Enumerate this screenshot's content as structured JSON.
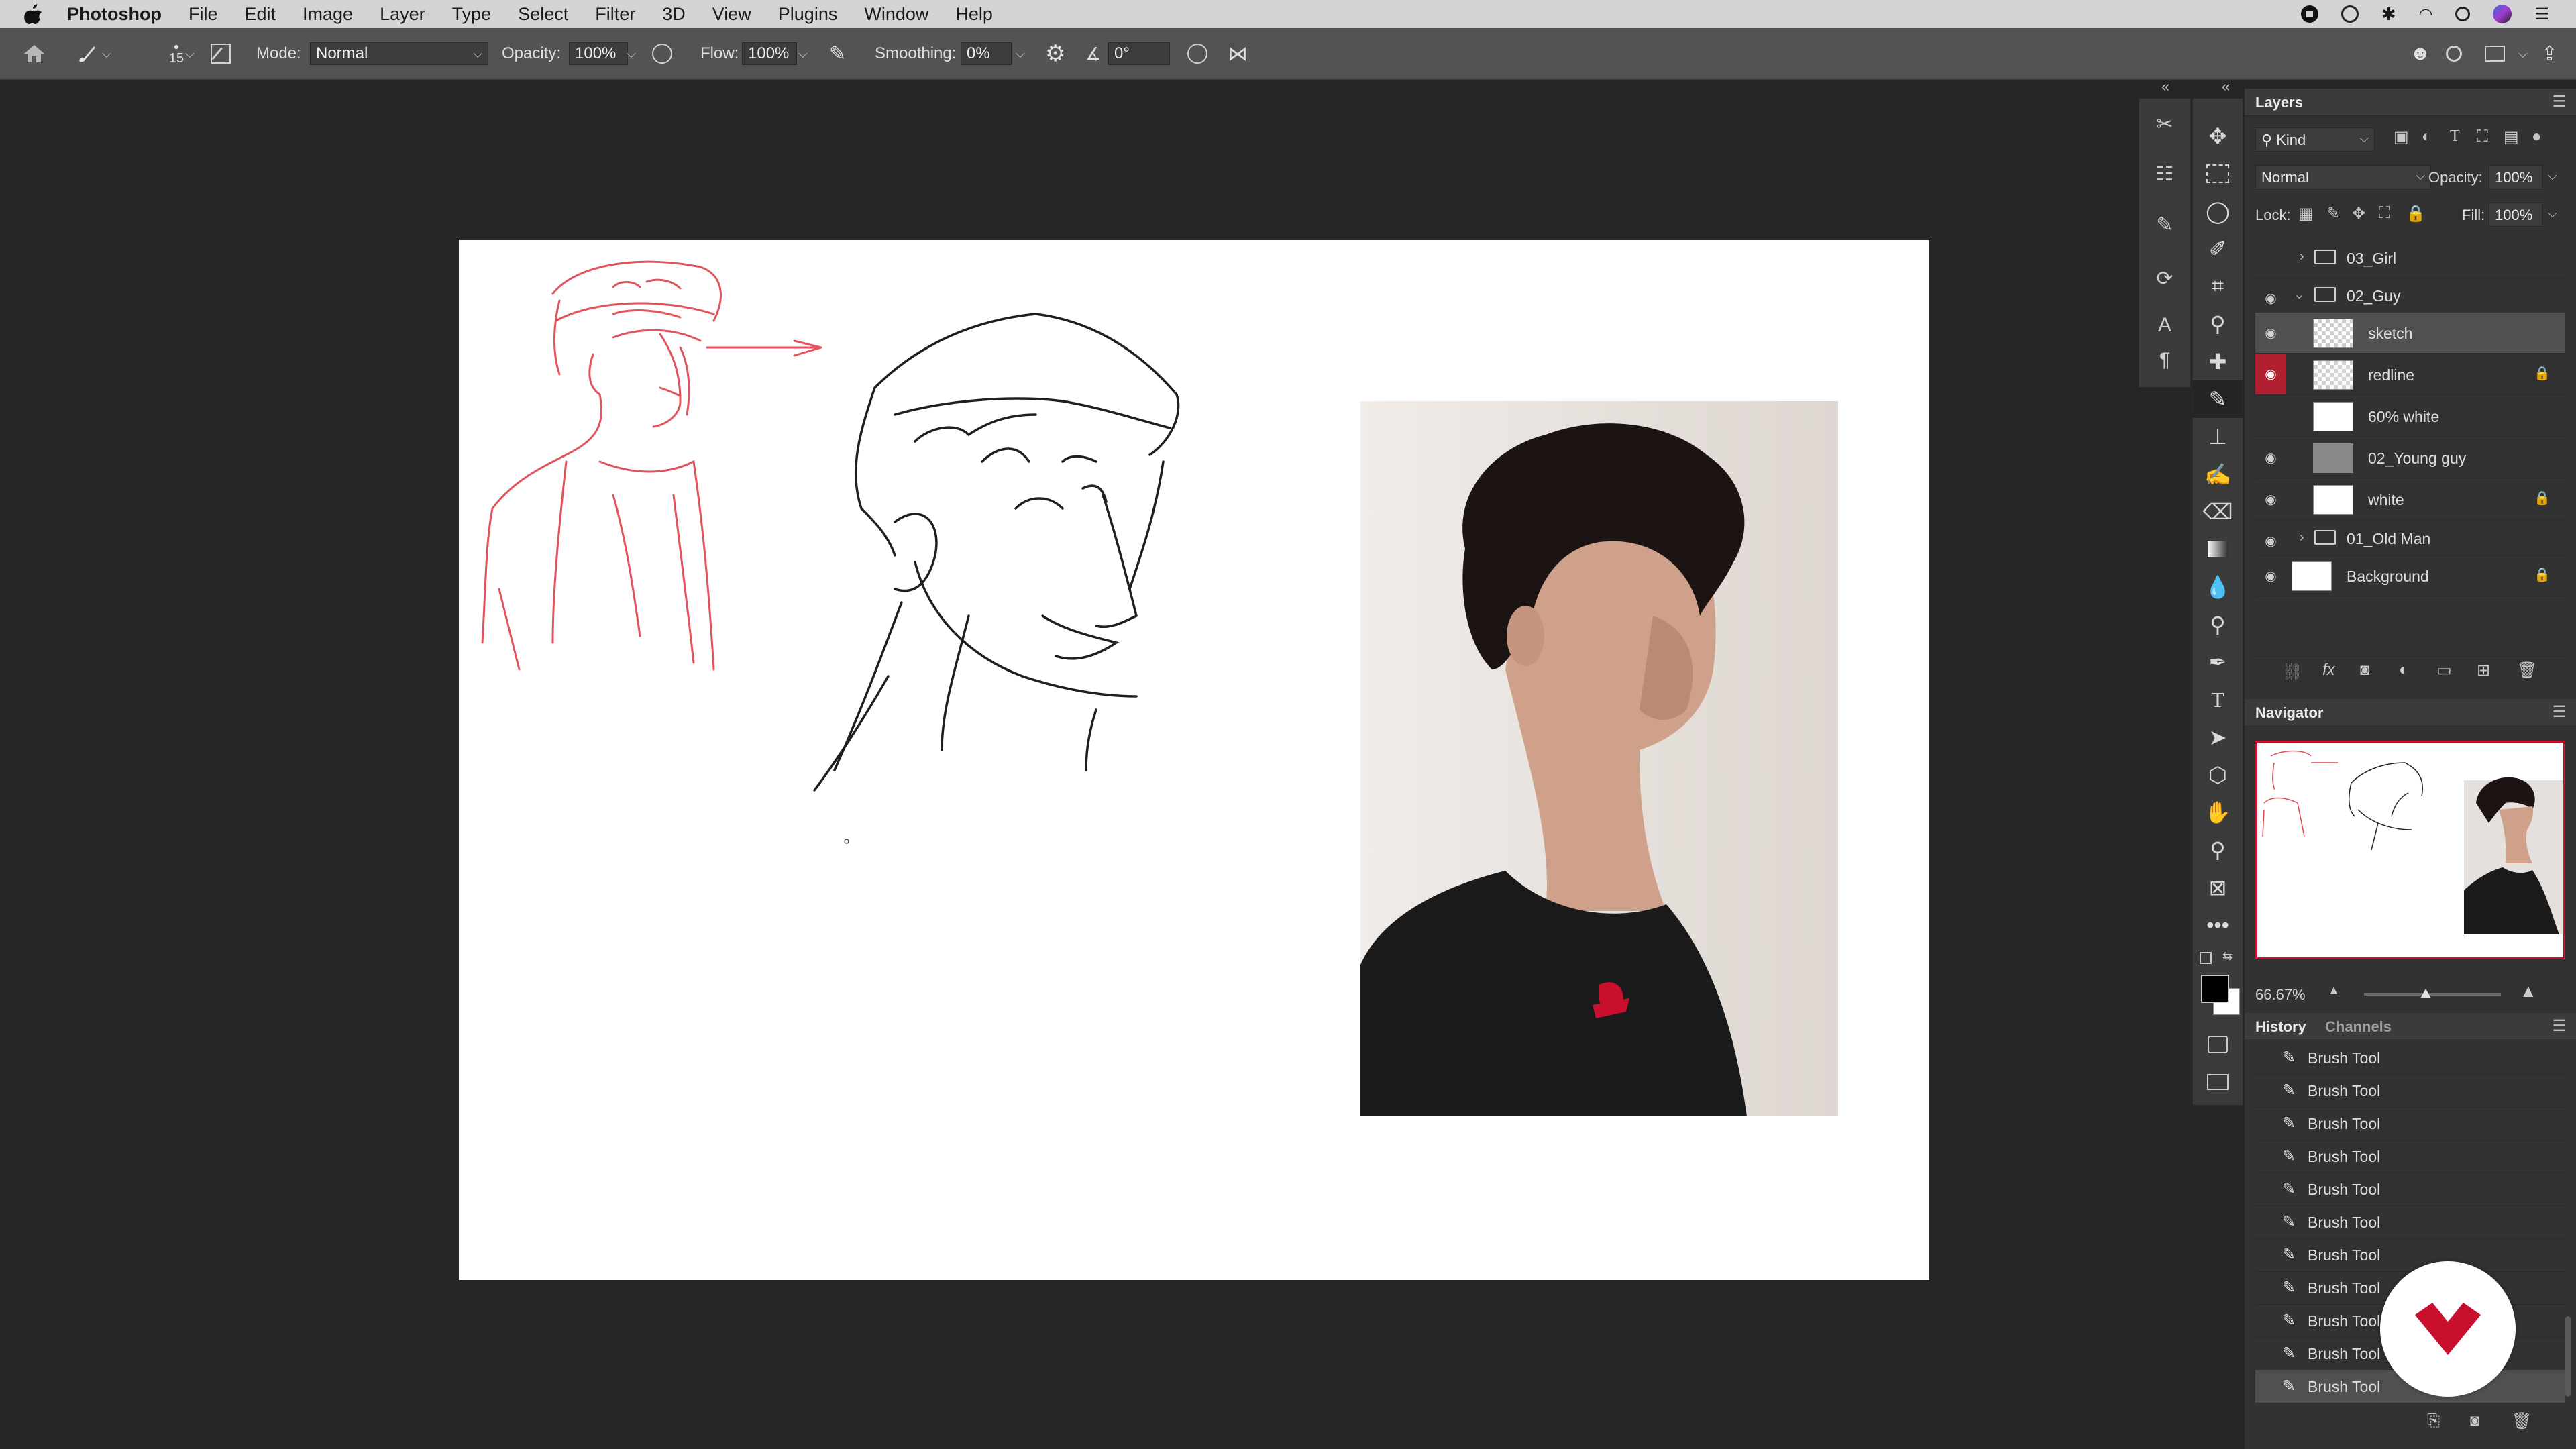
{
  "menubar": {
    "app_name": "Photoshop",
    "items": [
      "File",
      "Edit",
      "Image",
      "Layer",
      "Type",
      "Select",
      "Filter",
      "3D",
      "View",
      "Plugins",
      "Window",
      "Help"
    ]
  },
  "options": {
    "brush_size": "15",
    "mode_label": "Mode:",
    "mode_value": "Normal",
    "opacity_label": "Opacity:",
    "opacity_value": "100%",
    "flow_label": "Flow:",
    "flow_value": "100%",
    "smoothing_label": "Smoothing:",
    "smoothing_value": "0%",
    "angle_value": "0°"
  },
  "layers_panel": {
    "title": "Layers",
    "filter_kind": "Kind",
    "blend_mode": "Normal",
    "opacity_label": "Opacity:",
    "opacity_value": "100%",
    "lock_label": "Lock:",
    "fill_label": "Fill:",
    "fill_value": "100%",
    "layers": [
      {
        "name": "03_Girl"
      },
      {
        "name": "02_Guy"
      },
      {
        "name": "sketch"
      },
      {
        "name": "redline"
      },
      {
        "name": "60% white"
      },
      {
        "name": "02_Young guy"
      },
      {
        "name": "white"
      },
      {
        "name": "01_Old Man"
      },
      {
        "name": "Background"
      }
    ]
  },
  "navigator": {
    "title": "Navigator",
    "zoom": "66.67%",
    "zoom_slider_fraction": 0.45
  },
  "history_panel": {
    "tab_history": "History",
    "tab_channels": "Channels",
    "items": [
      "Brush Tool",
      "Brush Tool",
      "Brush Tool",
      "Brush Tool",
      "Brush Tool",
      "Brush Tool",
      "Brush Tool",
      "Brush Tool",
      "Brush Tool",
      "Brush Tool",
      "Brush Tool"
    ]
  },
  "colors": {
    "accent_red": "#b02030",
    "redline": "#e04a55",
    "logo_red": "#c8102e"
  }
}
